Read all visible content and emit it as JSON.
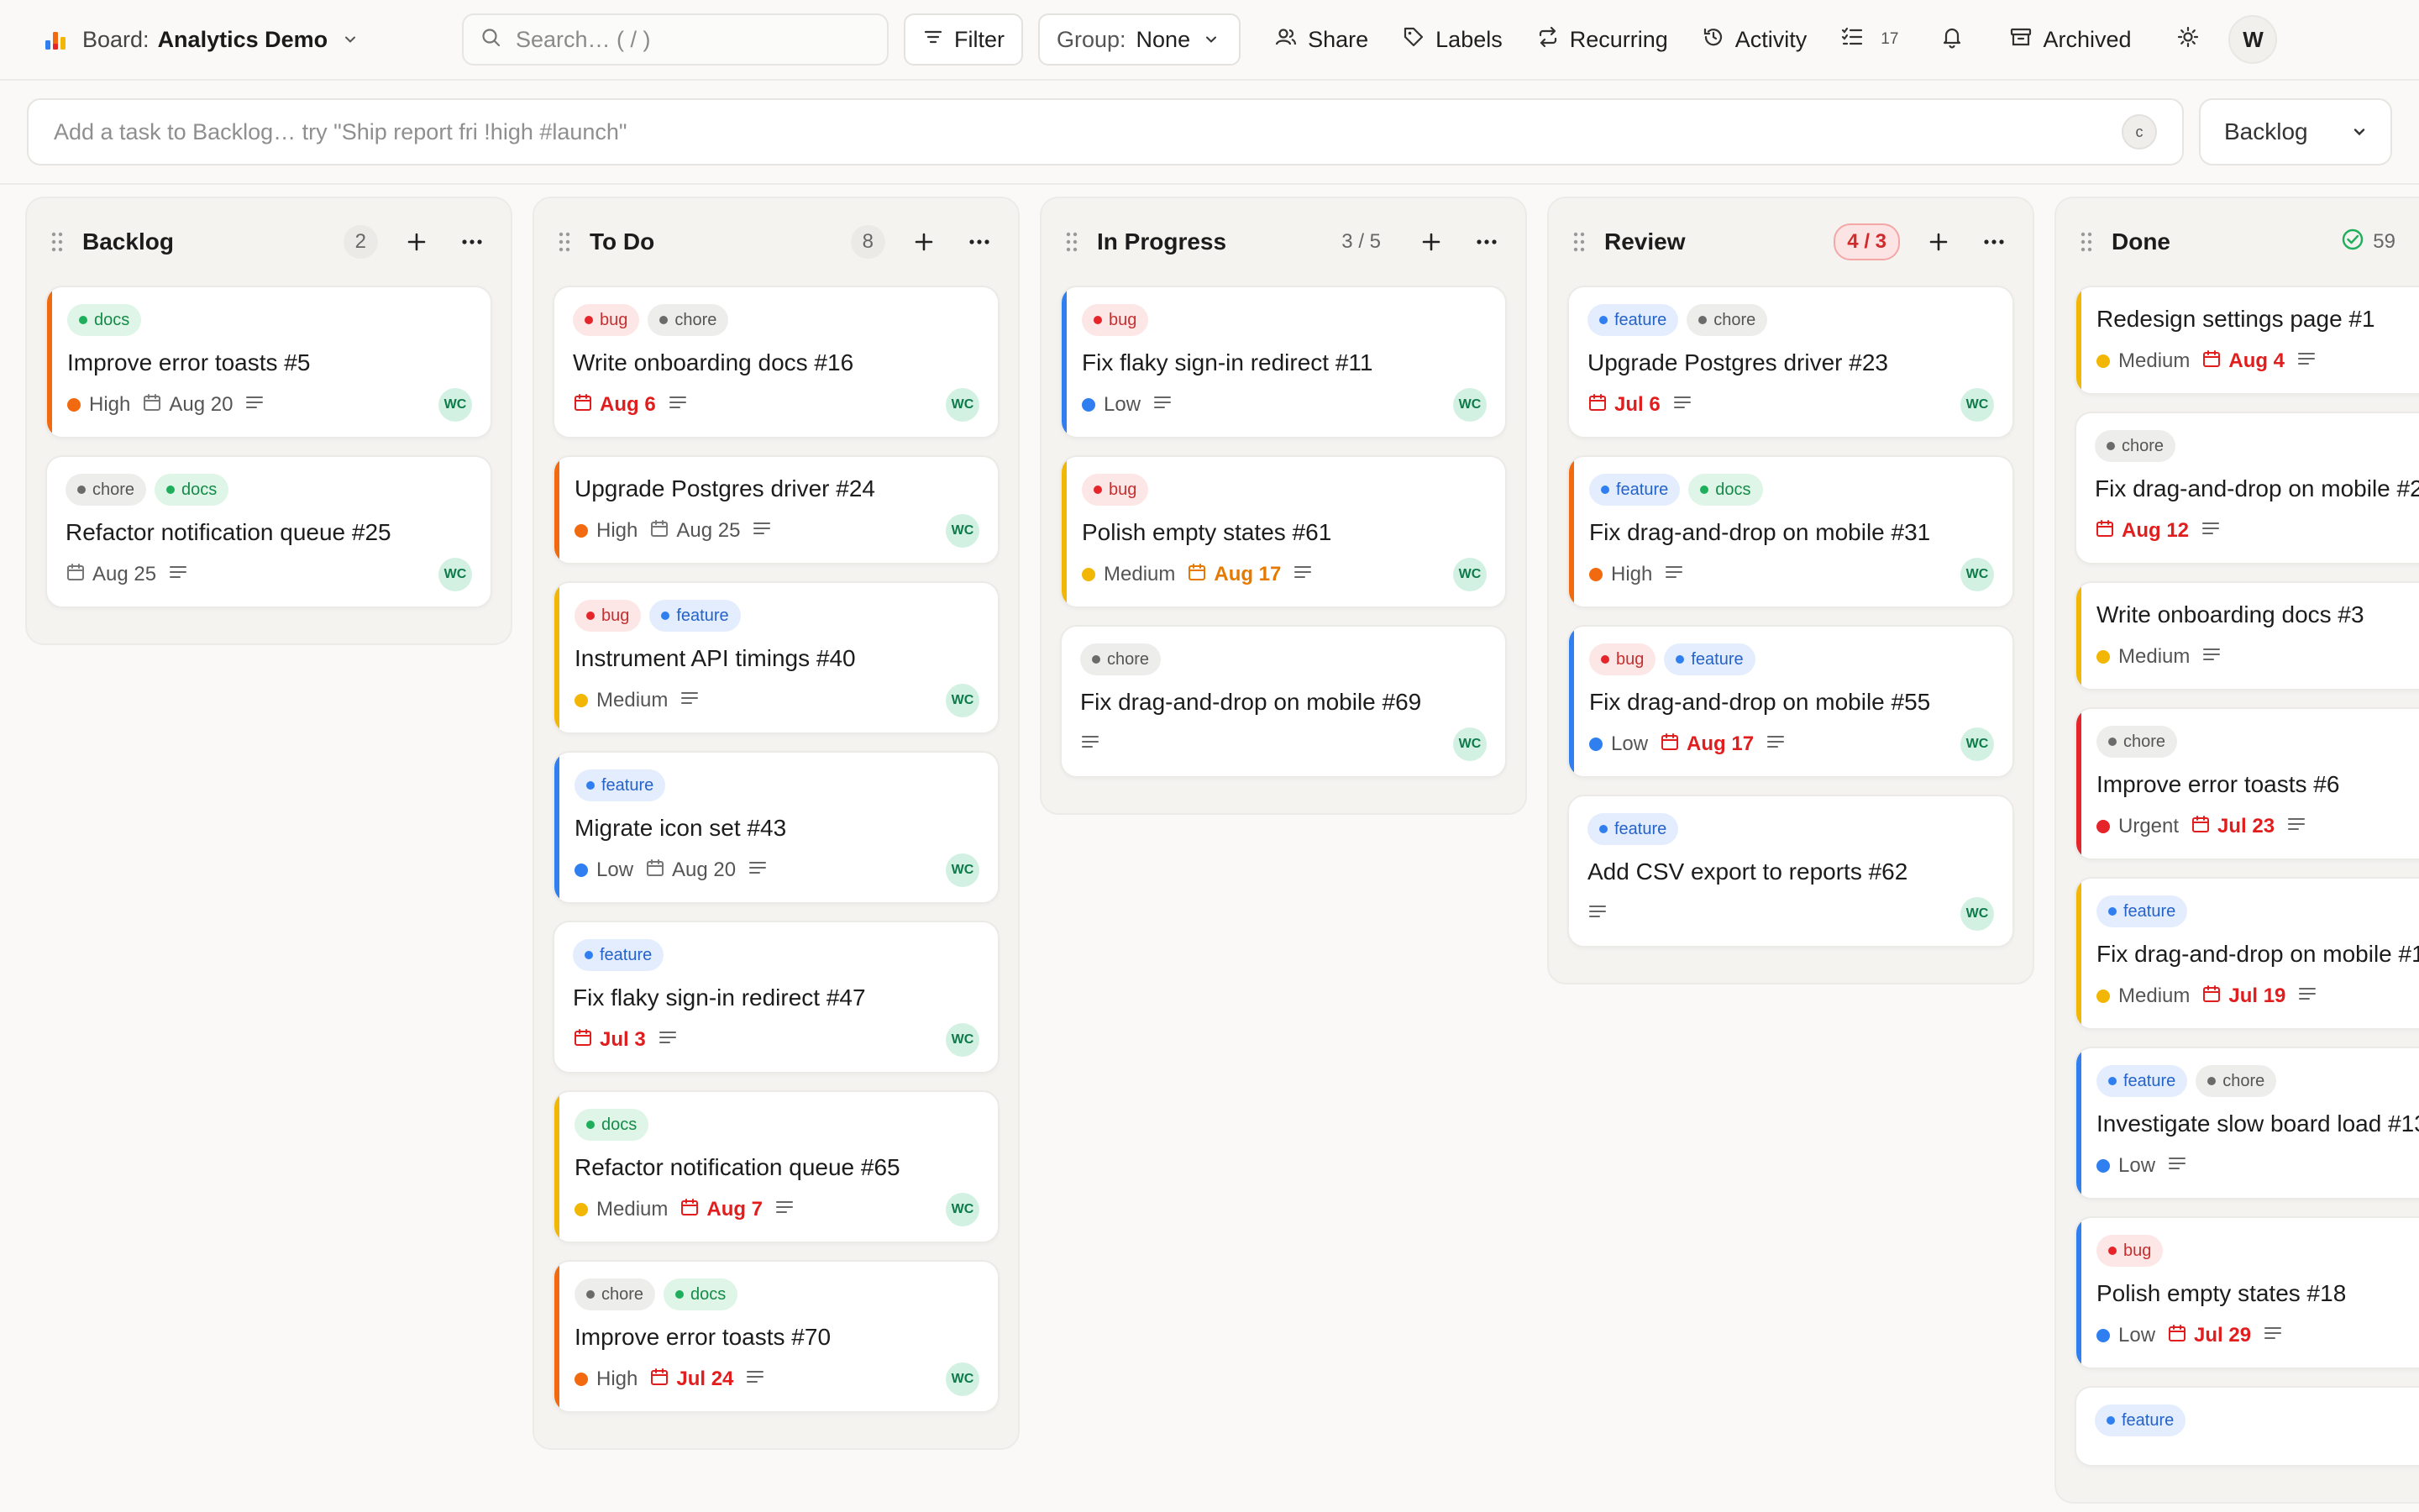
{
  "brand": {
    "prefix": "Board:",
    "name": "Analytics Demo"
  },
  "search": {
    "placeholder": "Search… ( / )"
  },
  "toolbar": {
    "filter": "Filter",
    "group_label": "Group:",
    "group_value": "None",
    "share": "Share",
    "labels": "Labels",
    "recurring": "Recurring",
    "activity": "Activity",
    "tasks_count": "17",
    "archived": "Archived",
    "user_initial": "W"
  },
  "quickadd": {
    "placeholder": "Add a task to Backlog…  try \"Ship report fri !high #launch\"",
    "shortcut": "c",
    "target": "Backlog"
  },
  "colors": {
    "high": "#f26a0f",
    "medium": "#f2b705",
    "low": "#2f7ff0",
    "urgent": "#e5252a",
    "tag_bug": "#e5252a",
    "tag_chore": "#6b6b6b",
    "tag_docs": "#1fae5b",
    "tag_feature": "#2f7ff0"
  },
  "columns": [
    {
      "title": "Backlog",
      "count": "2",
      "count_style": "normal",
      "cards": [
        {
          "tags": [
            "docs"
          ],
          "title": "Improve error toasts #5",
          "priority": "High",
          "due": "Aug 20",
          "due_style": "normal",
          "accent": "high",
          "avatar": "WC"
        },
        {
          "tags": [
            "chore",
            "docs"
          ],
          "title": "Refactor notification queue #25",
          "priority": "",
          "due": "Aug 25",
          "due_style": "normal",
          "accent": "",
          "avatar": "WC"
        }
      ]
    },
    {
      "title": "To Do",
      "count": "8",
      "count_style": "normal",
      "cards": [
        {
          "tags": [
            "bug",
            "chore"
          ],
          "title": "Write onboarding docs #16",
          "priority": "",
          "due": "Aug 6",
          "due_style": "overdue",
          "accent": "",
          "avatar": "WC"
        },
        {
          "tags": [],
          "title": "Upgrade Postgres driver #24",
          "priority": "High",
          "due": "Aug 25",
          "due_style": "normal",
          "accent": "high",
          "avatar": "WC"
        },
        {
          "tags": [
            "bug",
            "feature"
          ],
          "title": "Instrument API timings #40",
          "priority": "Medium",
          "due": "",
          "due_style": "normal",
          "accent": "medium",
          "avatar": "WC"
        },
        {
          "tags": [
            "feature"
          ],
          "title": "Migrate icon set #43",
          "priority": "Low",
          "due": "Aug 20",
          "due_style": "normal",
          "accent": "low",
          "avatar": "WC"
        },
        {
          "tags": [
            "feature"
          ],
          "title": "Fix flaky sign-in redirect #47",
          "priority": "",
          "due": "Jul 3",
          "due_style": "overdue",
          "accent": "",
          "avatar": "WC"
        },
        {
          "tags": [
            "docs"
          ],
          "title": "Refactor notification queue #65",
          "priority": "Medium",
          "due": "Aug 7",
          "due_style": "overdue",
          "accent": "medium",
          "avatar": "WC"
        },
        {
          "tags": [
            "chore",
            "docs"
          ],
          "title": "Improve error toasts #70",
          "priority": "High",
          "due": "Jul 24",
          "due_style": "overdue",
          "accent": "high",
          "avatar": "WC"
        }
      ]
    },
    {
      "title": "In Progress",
      "count": "3 / 5",
      "count_style": "plain",
      "cards": [
        {
          "tags": [
            "bug"
          ],
          "title": "Fix flaky sign-in redirect #11",
          "priority": "Low",
          "due": "",
          "due_style": "normal",
          "accent": "low",
          "avatar": "WC"
        },
        {
          "tags": [
            "bug"
          ],
          "title": "Polish empty states #61",
          "priority": "Medium",
          "due": "Aug 17",
          "due_style": "soon",
          "accent": "medium",
          "avatar": "WC"
        },
        {
          "tags": [
            "chore"
          ],
          "title": "Fix drag-and-drop on mobile #69",
          "priority": "",
          "due": "",
          "due_style": "normal",
          "accent": "",
          "avatar": "WC"
        }
      ]
    },
    {
      "title": "Review",
      "count": "4 / 3",
      "count_style": "warn",
      "cards": [
        {
          "tags": [
            "feature",
            "chore"
          ],
          "title": "Upgrade Postgres driver #23",
          "priority": "",
          "due": "Jul 6",
          "due_style": "overdue",
          "accent": "",
          "avatar": "WC"
        },
        {
          "tags": [
            "feature",
            "docs"
          ],
          "title": "Fix drag-and-drop on mobile #31",
          "priority": "High",
          "due": "",
          "due_style": "normal",
          "accent": "high",
          "avatar": "WC"
        },
        {
          "tags": [
            "bug",
            "feature"
          ],
          "title": "Fix drag-and-drop on mobile #55",
          "priority": "Low",
          "due": "Aug 17",
          "due_style": "overdue",
          "accent": "low",
          "avatar": "WC"
        },
        {
          "tags": [
            "feature"
          ],
          "title": "Add CSV export to reports #62",
          "priority": "",
          "due": "",
          "due_style": "normal",
          "accent": "",
          "avatar": "WC"
        }
      ]
    },
    {
      "title": "Done",
      "count": "59",
      "count_style": "ok",
      "cards": [
        {
          "tags": [],
          "title": "Redesign settings page #1",
          "priority": "Medium",
          "due": "Aug 4",
          "due_style": "overdue",
          "accent": "medium",
          "avatar": ""
        },
        {
          "tags": [
            "chore"
          ],
          "title": "Fix drag-and-drop on mobile #2",
          "priority": "",
          "due": "Aug 12",
          "due_style": "overdue",
          "accent": "",
          "avatar": ""
        },
        {
          "tags": [],
          "title": "Write onboarding docs #3",
          "priority": "Medium",
          "due": "",
          "due_style": "normal",
          "accent": "medium",
          "avatar": ""
        },
        {
          "tags": [
            "chore"
          ],
          "title": "Improve error toasts #6",
          "priority": "Urgent",
          "due": "Jul 23",
          "due_style": "overdue",
          "accent": "urgent",
          "avatar": ""
        },
        {
          "tags": [
            "feature"
          ],
          "title": "Fix drag-and-drop on mobile #1",
          "priority": "Medium",
          "due": "Jul 19",
          "due_style": "overdue",
          "accent": "medium",
          "avatar": ""
        },
        {
          "tags": [
            "feature",
            "chore"
          ],
          "title": "Investigate slow board load #13",
          "priority": "Low",
          "due": "",
          "due_style": "normal",
          "accent": "low",
          "avatar": ""
        },
        {
          "tags": [
            "bug"
          ],
          "title": "Polish empty states #18",
          "priority": "Low",
          "due": "Jul 29",
          "due_style": "overdue",
          "accent": "low",
          "avatar": ""
        },
        {
          "tags": [
            "feature"
          ],
          "title": "",
          "priority": "",
          "due": "",
          "due_style": "normal",
          "accent": "",
          "avatar": ""
        }
      ]
    }
  ]
}
